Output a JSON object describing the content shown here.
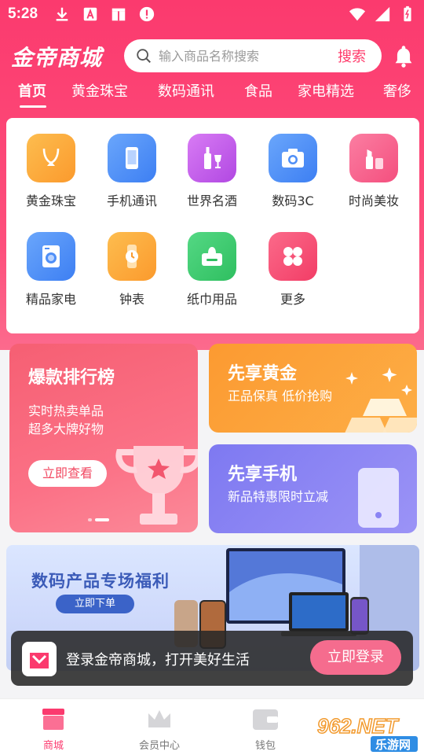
{
  "status_bar": {
    "time": "5:28"
  },
  "header": {
    "logo_text": "金帝商城",
    "search_placeholder": "输入商品名称搜索",
    "search_button": "搜索"
  },
  "tabs": [
    {
      "label": "首页"
    },
    {
      "label": "黄金珠宝"
    },
    {
      "label": "数码通讯"
    },
    {
      "label": "食品"
    },
    {
      "label": "家电精选"
    },
    {
      "label": "奢侈"
    }
  ],
  "categories": [
    {
      "label": "黄金珠宝",
      "icon": "necklace-icon",
      "color": "#fca83a"
    },
    {
      "label": "手机通讯",
      "icon": "phone-icon",
      "color": "#4f8ff7"
    },
    {
      "label": "世界名酒",
      "icon": "wine-icon",
      "color": "#c45be8"
    },
    {
      "label": "数码3C",
      "icon": "camera-icon",
      "color": "#4f8ff7"
    },
    {
      "label": "时尚美妆",
      "icon": "lipstick-icon",
      "color": "#f8648c"
    },
    {
      "label": "精品家电",
      "icon": "washer-icon",
      "color": "#4f8ff7"
    },
    {
      "label": "钟表",
      "icon": "watch-icon",
      "color": "#fca83a"
    },
    {
      "label": "纸巾用品",
      "icon": "tissue-icon",
      "color": "#3fcb6e"
    },
    {
      "label": "更多",
      "icon": "more-icon",
      "color": "#f8476f"
    }
  ],
  "promo": {
    "rank": {
      "title": "爆款排行榜",
      "line1": "实时热卖单品",
      "line2": "超多大牌好物",
      "button": "立即查看"
    },
    "gold": {
      "title": "先享黄金",
      "subtitle": "正品保真 低价抢购"
    },
    "phone": {
      "title": "先享手机",
      "subtitle": "新品特惠限时立减"
    }
  },
  "banner": {
    "title": "数码产品专场福利",
    "button": "立即下单"
  },
  "login_bar": {
    "message": "登录金帝商城，打开美好生活",
    "button": "立即登录"
  },
  "tabbar": [
    {
      "label": "商城",
      "icon": "store-icon"
    },
    {
      "label": "会员中心",
      "icon": "crown-icon"
    },
    {
      "label": "钱包",
      "icon": "wallet-icon"
    }
  ],
  "watermark": {
    "text1": "962.NET",
    "text2": "乐游网"
  },
  "colors": {
    "brand": "#fb3a6e",
    "accent_gold": "#fca83a",
    "accent_purple": "#8a84f4"
  }
}
